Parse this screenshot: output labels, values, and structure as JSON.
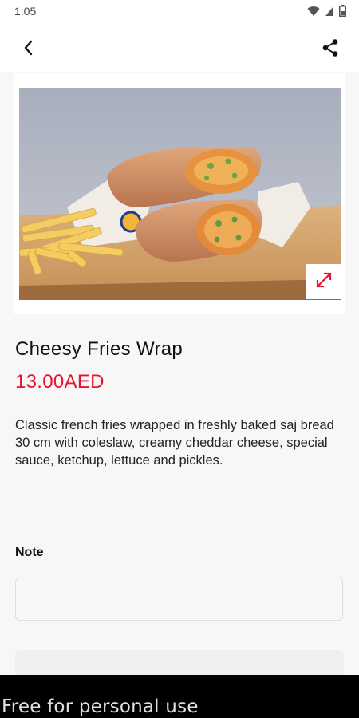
{
  "status_bar": {
    "time": "1:05",
    "icons": [
      "wifi-icon",
      "signal-icon",
      "battery-icon"
    ]
  },
  "app_bar": {
    "back_icon": "chevron-left-icon",
    "share_icon": "share-icon"
  },
  "product": {
    "name": "Cheesy Fries Wrap",
    "price": "13.00AED",
    "description": "Classic french fries wrapped in freshly baked saj bread 30 cm with coleslaw, creamy cheddar cheese, special sauce, ketchup, lettuce and pickles.",
    "image_icon": "expand-icon"
  },
  "note": {
    "label": "Note",
    "value": "",
    "placeholder": ""
  },
  "watermark": {
    "text": "Free for personal use"
  },
  "colors": {
    "accent": "#e8132f",
    "background": "#f7f7f7",
    "card": "#ffffff"
  }
}
